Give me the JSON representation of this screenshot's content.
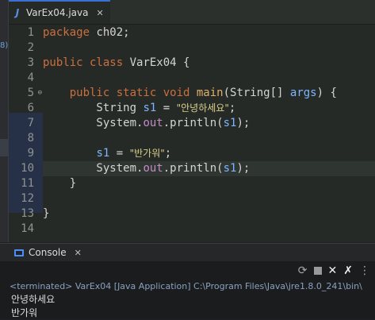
{
  "editor": {
    "tab_title": "VarEx04.java",
    "file_icon_glyph": "J"
  },
  "left_strip_fragment": "8)",
  "code_lines": [
    {
      "n": "1",
      "segments": [
        [
          "kw",
          "package"
        ],
        [
          "src",
          " ch02;"
        ]
      ]
    },
    {
      "n": "2",
      "segments": []
    },
    {
      "n": "3",
      "segments": [
        [
          "kw",
          "public class"
        ],
        [
          "src",
          " VarEx04 {"
        ]
      ]
    },
    {
      "n": "4",
      "segments": []
    },
    {
      "n": "5",
      "fold": true,
      "segments": [
        [
          "src",
          "    "
        ],
        [
          "kw",
          "public static void"
        ],
        [
          "src",
          " "
        ],
        [
          "meth",
          "main"
        ],
        [
          "src",
          "(String[] "
        ],
        [
          "var",
          "args"
        ],
        [
          "src",
          ") {"
        ]
      ]
    },
    {
      "n": "6",
      "segments": [
        [
          "src",
          "        String "
        ],
        [
          "var",
          "s1"
        ],
        [
          "src",
          " = "
        ],
        [
          "str",
          "\"안녕하세요\""
        ],
        [
          "src",
          ";"
        ]
      ]
    },
    {
      "n": "7",
      "segments": [
        [
          "src",
          "        System."
        ],
        [
          "field",
          "out"
        ],
        [
          "src",
          ".println("
        ],
        [
          "var",
          "s1"
        ],
        [
          "src",
          ");"
        ]
      ]
    },
    {
      "n": "8",
      "segments": []
    },
    {
      "n": "9",
      "segments": [
        [
          "src",
          "        "
        ],
        [
          "var",
          "s1"
        ],
        [
          "src",
          " = "
        ],
        [
          "str",
          "\"반가워\""
        ],
        [
          "src",
          ";"
        ]
      ]
    },
    {
      "n": "10",
      "current": true,
      "segments": [
        [
          "src",
          "        System."
        ],
        [
          "field",
          "out"
        ],
        [
          "src",
          ".println("
        ],
        [
          "var",
          "s1"
        ],
        [
          "src",
          ");"
        ]
      ]
    },
    {
      "n": "11",
      "segments": [
        [
          "src",
          "    }"
        ]
      ]
    },
    {
      "n": "12",
      "segments": []
    },
    {
      "n": "13",
      "segments": [
        [
          "src",
          "}"
        ]
      ]
    },
    {
      "n": "14",
      "segments": []
    }
  ],
  "console": {
    "tab_label": "Console",
    "terminated_text": "<terminated> VarEx04 [Java Application] C:\\Program Files\\Java\\jre1.8.0_241\\bin\\",
    "output_lines": [
      "안녕하세요",
      "반가워"
    ],
    "toolbar": [
      "pin-icon",
      "stop-icon",
      "remove-launch-icon",
      "remove-all-terminated-icon"
    ]
  },
  "colors": {
    "keyword": "#cc6f3e",
    "string": "#d8d08a",
    "variable": "#7fb5ff",
    "field": "#c38bc3",
    "method": "#e0b069",
    "accent": "#3b6fd1"
  }
}
